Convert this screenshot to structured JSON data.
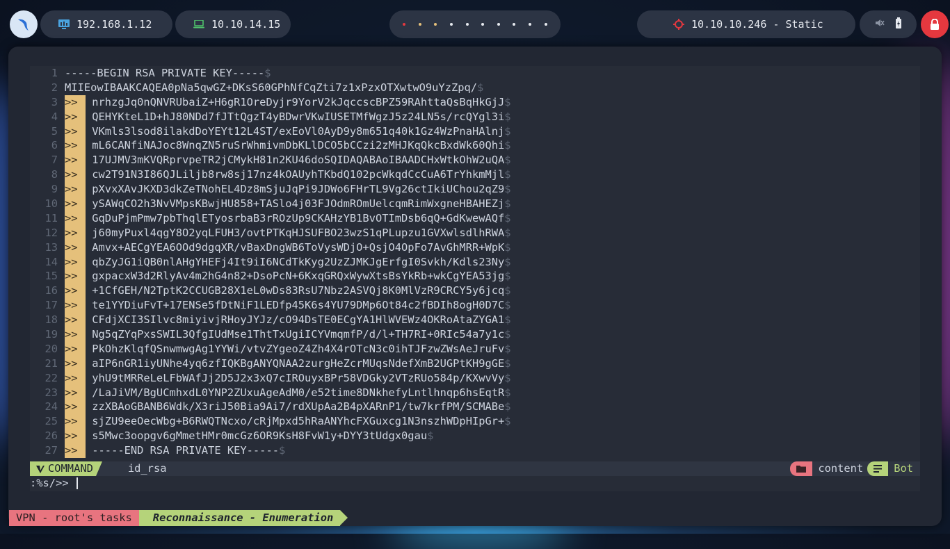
{
  "topbar": {
    "ip_local": "192.168.1.12",
    "ip_vpn": "10.10.14.15",
    "target": "10.10.10.246 - Static",
    "workspaces_active_colors": [
      "#e5383f",
      "#e5c07b",
      "#e5c07b"
    ],
    "workspace_count": 10
  },
  "editor": {
    "lines": [
      {
        "n": "1",
        "marker": "",
        "text": "-----BEGIN RSA PRIVATE KEY-----",
        "eol": "$"
      },
      {
        "n": "2",
        "marker": "",
        "text": "MIIEowIBAAKCAQEA0pNa5qwGZ+DKsS60GPhNfCqZti7z1xPzxOTXwtwO9uYzZpq/",
        "eol": "$"
      },
      {
        "n": "3",
        "marker": ">>",
        "text": " nrhzgJq0nQNVRUbaiZ+H6gR1OreDyjr9YorV2kJqccscBPZ59RAhttaQsBqHkGjJ",
        "eol": "$"
      },
      {
        "n": "4",
        "marker": ">>",
        "text": " QEHYKteL1D+hJ80NDd7fJTtQgzT4yBDwrVKwIUSETMfWgzJ5z24LN5s/rcQYgl3i",
        "eol": "$"
      },
      {
        "n": "5",
        "marker": ">>",
        "text": " VKmls3lsod8ilakdDoYEYt12L4ST/exEoVl0AyD9y8m651q40k1Gz4WzPnaHAlnj",
        "eol": "$"
      },
      {
        "n": "6",
        "marker": ">>",
        "text": " mL6CANfiNAJoc8WnqZN5ruSrWhmivmDbKLlDCO5bCCzi2zMHJKqQkcBxdWk60Qhi",
        "eol": "$"
      },
      {
        "n": "7",
        "marker": ">>",
        "text": " 17UJMV3mKVQRprvpeTR2jCMykH81n2KU46doSQIDAQABAoIBAADCHxWtkOhW2uQA",
        "eol": "$"
      },
      {
        "n": "8",
        "marker": ">>",
        "text": " cw2T91N3I86QJLiljb8rw8sj17nz4kOAUyhTKbdQ102pcWkqdCcCuA6TrYhkmMjl",
        "eol": "$"
      },
      {
        "n": "9",
        "marker": ">>",
        "text": " pXvxXAvJKXD3dkZeTNohEL4Dz8mSjuJqPi9JDWo6FHrTL9Vg26ctIkiUChou2qZ9",
        "eol": "$"
      },
      {
        "n": "10",
        "marker": ">>",
        "text": " ySAWqCO2h3NvVMpsKBwjHU858+TASlo4j03FJOdmROmUelcqmRimWxgneHBAHEZj",
        "eol": "$"
      },
      {
        "n": "11",
        "marker": ">>",
        "text": " GqDuPjmPmw7pbThqlETyosrbaB3rROzUp9CKAHzYB1BvOTImDsb6qQ+GdKwewAQf",
        "eol": "$"
      },
      {
        "n": "12",
        "marker": ">>",
        "text": " j60myPuxl4qgY8O2yqLFUH3/ovtPTKqHJSUFBO23wzS1qPLupzu1GVXwlsdlhRWA",
        "eol": "$"
      },
      {
        "n": "13",
        "marker": ">>",
        "text": " Amvx+AECgYEA6OOd9dgqXR/vBaxDngWB6ToVysWDjO+QsjO4OpFo7AvGhMRR+WpK",
        "eol": "$"
      },
      {
        "n": "14",
        "marker": ">>",
        "text": " qbZyJG1iQB0nlAHgYHEFj4It9iI6NCdTkKyg2UzZJMKJgErfgI0Svkh/Kdls23Ny",
        "eol": "$"
      },
      {
        "n": "15",
        "marker": ">>",
        "text": " gxpacxW3d2RlyAv4m2hG4n82+DsoPcN+6KxqGRQxWywXtsBsYkRb+wkCgYEA53jg",
        "eol": "$"
      },
      {
        "n": "16",
        "marker": ">>",
        "text": " +1CfGEH/N2TptK2CCUGB28X1eL0wDs83RsU7Nbz2ASVQj8K0MlVzR9CRCY5y6jcq",
        "eol": "$"
      },
      {
        "n": "17",
        "marker": ">>",
        "text": " te1YYDiuFvT+17ENSe5fDtNiF1LEDfp45K6s4YU79DMp6Ot84c2fBDIh8ogH0D7C",
        "eol": "$"
      },
      {
        "n": "18",
        "marker": ">>",
        "text": " CFdjXCI3SIlvc8miyivjRHoyJYJz/cO94DsTE0ECgYA1HlWVEWz4OKRoAtaZYGA1",
        "eol": "$"
      },
      {
        "n": "19",
        "marker": ">>",
        "text": " Ng5qZYqPxsSWIL3QfgIUdMse1ThtTxUgiICYVmqmfP/d/l+TH7RI+0RIc54a7y1c",
        "eol": "$"
      },
      {
        "n": "20",
        "marker": ">>",
        "text": " PkOhzKlqfQSnwmwgAg1YYWi/vtvZYgeoZ4Zh4X4rOTcN3c0ihTJFzwZWsAeJruFv",
        "eol": "$"
      },
      {
        "n": "21",
        "marker": ">>",
        "text": " aIP6nGR1iyUNhe4yq6zfIQKBgANYQNAA2zurgHeZcrMUqsNdefXmB2UGPtKH9gGE",
        "eol": "$"
      },
      {
        "n": "22",
        "marker": ">>",
        "text": " yhU9tMRReLeLFbWAfJj2D5J2x3xQ7cIROuyxBPr58VDGky2VTzRUo584p/KXwvVy",
        "eol": "$"
      },
      {
        "n": "23",
        "marker": ">>",
        "text": " /LaJiVM/BgUCmhxdL0YNP2ZUxuAgeAdM0/e52time8DNkhefyLntlhnqp6hsEqtR",
        "eol": "$"
      },
      {
        "n": "24",
        "marker": ">>",
        "text": " zzXBAoGBANB6Wdk/X3riJ50Bia9Ai7/rdXUpAa2B4pXARnP1/tw7krfPM/SCMABe",
        "eol": "$"
      },
      {
        "n": "25",
        "marker": ">>",
        "text": " sjZU9eeOecWbg+B6RWQTNcxo/cRjMpxd5hRaANYhcFXGuxcg1N3nszhWDpHIpGr+",
        "eol": "$"
      },
      {
        "n": "26",
        "marker": ">>",
        "text": " s5Mwc3oopgv6gMmetHMr0mcGz6OR9KsH8FvW1y+DYY3tUdgx0gau",
        "eol": "$"
      },
      {
        "n": "27",
        "marker": ">>",
        "text": " -----END RSA PRIVATE KEY-----",
        "eol": "$"
      }
    ],
    "statusline": {
      "mode": "COMMAND",
      "filename": "id_rsa",
      "directory": "content",
      "position": "Bot"
    },
    "command": ":%s/>> "
  },
  "tmux": {
    "session": "VPN - root's tasks",
    "window": "Reconnaissance - Enumeration"
  }
}
